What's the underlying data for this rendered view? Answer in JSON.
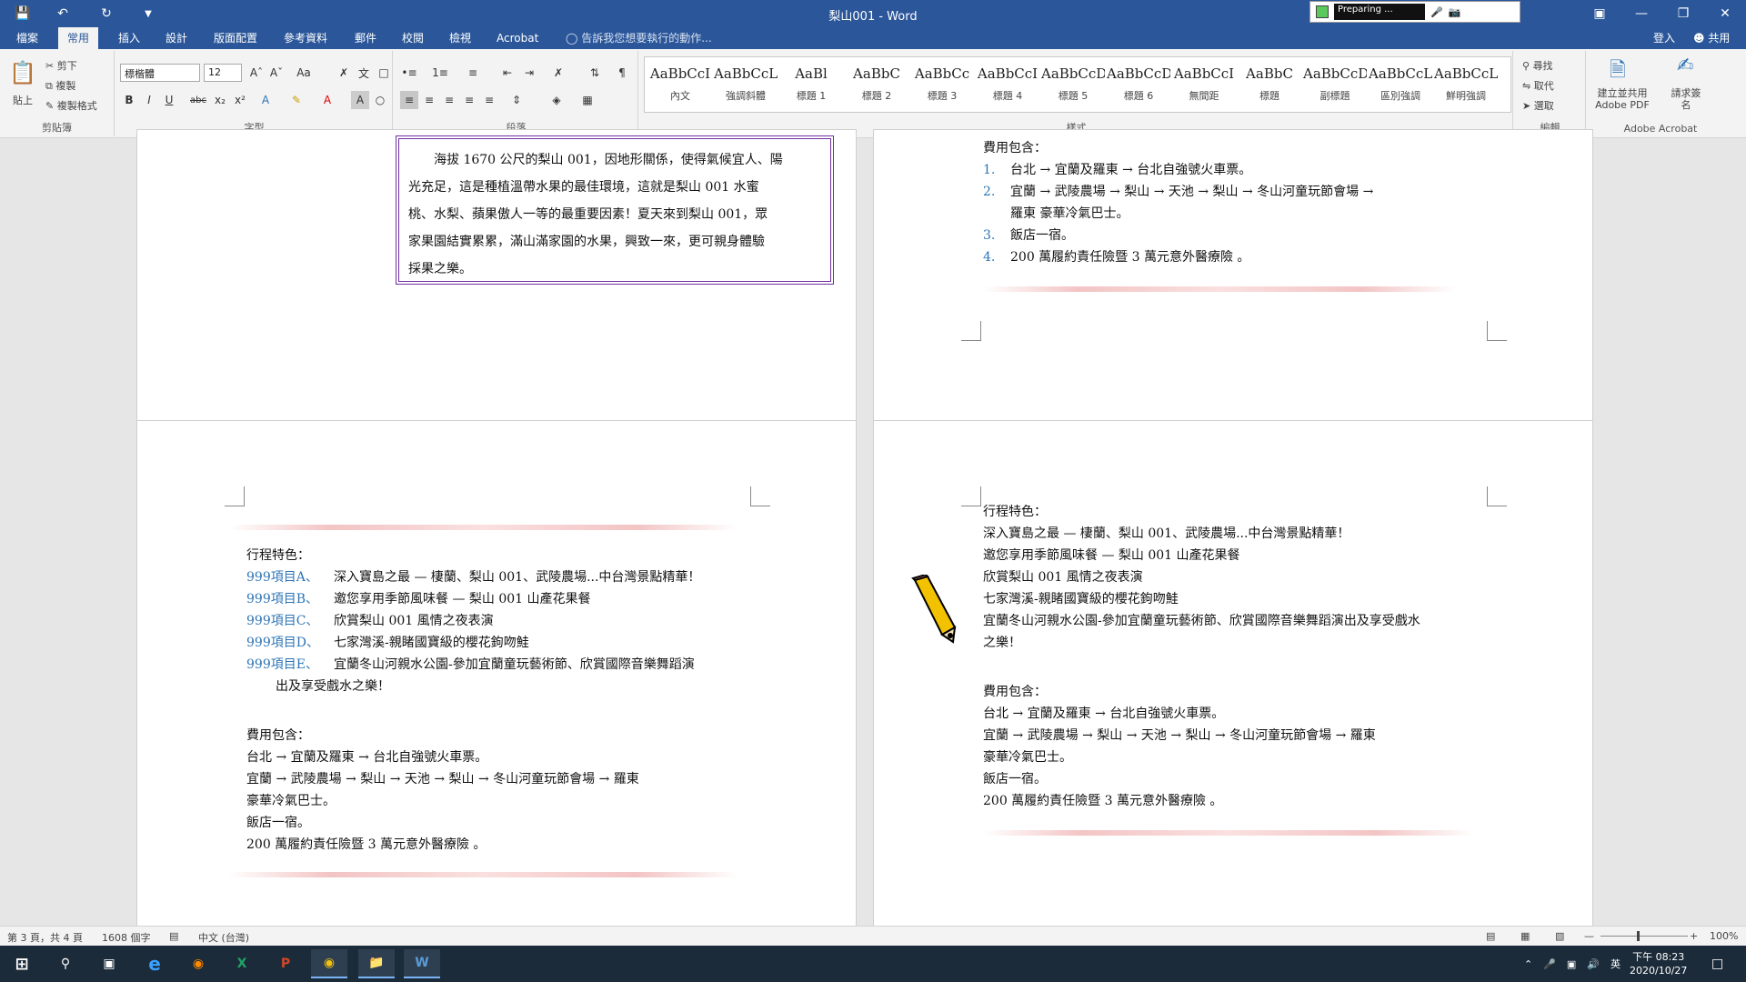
{
  "app": {
    "title": "梨山001 - Word",
    "notif": "Preparing ..."
  },
  "tabs": [
    "檔案",
    "常用",
    "插入",
    "設計",
    "版面配置",
    "參考資料",
    "郵件",
    "校閱",
    "檢視",
    "Acrobat"
  ],
  "tellme": "告訴我您想要執行的動作...",
  "account": {
    "signin": "登入",
    "share": "共用"
  },
  "ribbon": {
    "clipboard": {
      "paste": "貼上",
      "cut": "剪下",
      "copy": "複製",
      "format_painter": "複製格式",
      "label": "剪貼簿"
    },
    "font": {
      "name": "標楷體",
      "size": "12",
      "label": "字型"
    },
    "paragraph": {
      "label": "段落"
    },
    "styles": {
      "label": "樣式",
      "items": [
        {
          "preview": "AaBbCcI",
          "name": "內文"
        },
        {
          "preview": "AaBbCcL",
          "name": "強調斜體"
        },
        {
          "preview": "AaBl",
          "name": "標題 1"
        },
        {
          "preview": "AaBbC",
          "name": "標題 2"
        },
        {
          "preview": "AaBbCc",
          "name": "標題 3"
        },
        {
          "preview": "AaBbCcI",
          "name": "標題 4"
        },
        {
          "preview": "AaBbCcDdI",
          "name": "標題 5"
        },
        {
          "preview": "AaBbCcDdEe",
          "name": "標題 6"
        },
        {
          "preview": "AaBbCcI",
          "name": "無間距"
        },
        {
          "preview": "AaBbC",
          "name": "標題"
        },
        {
          "preview": "AaBbCcD",
          "name": "副標題"
        },
        {
          "preview": "AaBbCcL",
          "name": "區別強調"
        },
        {
          "preview": "AaBbCcL",
          "name": "鮮明強調"
        }
      ]
    },
    "editing": {
      "find": "尋找",
      "replace": "取代",
      "select": "選取",
      "label": "編輯"
    },
    "acrobat": {
      "create_pdf": "建立並共用 Adobe PDF",
      "request_sign": "請求簽名",
      "label": "Adobe Acrobat"
    }
  },
  "doc": {
    "intro": [
      "海拔 1670 公尺的梨山 001，因地形關係，使得氣候宜人、陽",
      "光充足，這是種植溫帶水果的最佳環境，這就是梨山 001 水蜜",
      "桃、水梨、蘋果傲人一等的最重要因素！夏天來到梨山 001，眾",
      "家果園結實累累，滿山滿家園的水果，興致一來，更可親身體驗",
      "採果之樂。"
    ],
    "fee_title": "費用包含：",
    "fee_numbered": [
      {
        "n": "1.",
        "t": "台北 → 宜蘭及羅東 → 台北自強號火車票。"
      },
      {
        "n": "2.",
        "t": "宜蘭 → 武陵農場 → 梨山 → 天池 → 梨山 → 冬山河童玩節會場 →"
      },
      {
        "n": "",
        "t": "羅東 豪華冷氣巴士。"
      },
      {
        "n": "3.",
        "t": "飯店一宿。"
      },
      {
        "n": "4.",
        "t": "200 萬履約責任險暨 3 萬元意外醫療險 。"
      }
    ],
    "trip_title": "行程特色：",
    "trip_items": [
      {
        "label": "999項目A、",
        "t": "深入寶島之最 — 棲蘭、梨山 001、武陵農場...中台灣景點精華！"
      },
      {
        "label": "999項目B、",
        "t": "邀您享用季節風味餐 — 梨山 001 山產花果餐"
      },
      {
        "label": "999項目C、",
        "t": "欣賞梨山 001 風情之夜表演"
      },
      {
        "label": "999項目D、",
        "t": "七家灣溪-親睹國寶級的櫻花鉤吻鮭"
      },
      {
        "label": "999項目E、",
        "t": "宜蘭冬山河親水公園-參加宜蘭童玩藝術節、欣賞國際音樂舞蹈演"
      }
    ],
    "trip_cont": "出及享受戲水之樂！",
    "fee_plain": [
      "台北 → 宜蘭及羅東 → 台北自強號火車票。",
      "宜蘭 → 武陵農場 → 梨山 → 天池 → 梨山 → 冬山河童玩節會場 → 羅東",
      "豪華冷氣巴士。",
      "飯店一宿。",
      "200 萬履約責任險暨 3 萬元意外醫療險 。"
    ],
    "trip_plain": [
      "深入寶島之最 — 棲蘭、梨山 001、武陵農場...中台灣景點精華！",
      "邀您享用季節風味餐 — 梨山 001 山產花果餐",
      "欣賞梨山 001 風情之夜表演",
      "七家灣溪-親睹國寶級的櫻花鉤吻鮭",
      "宜蘭冬山河親水公園-參加宜蘭童玩藝術節、欣賞國際音樂舞蹈演出及享受戲水",
      "之樂！"
    ],
    "fee_plain_p4": [
      "台北 → 宜蘭及羅東 → 台北自強號火車票。",
      "宜蘭 → 武陵農場 → 梨山 → 天池 → 梨山 → 冬山河童玩節會場 → 羅東",
      "豪華冷氣巴士。",
      "飯店一宿。",
      "200 萬履約責任險暨 3 萬元意外醫療險 。"
    ]
  },
  "status": {
    "page": "第 3 頁，共 4 頁",
    "words": "1608 個字",
    "lang": "中文 (台灣)",
    "zoom": "100%"
  },
  "tray": {
    "time": "下午 08:23",
    "date": "2020/10/27",
    "ime": "英"
  },
  "colors": {
    "accent": "#2b579a",
    "list_blue": "#2e74b5",
    "border_purple": "#7030a0"
  }
}
